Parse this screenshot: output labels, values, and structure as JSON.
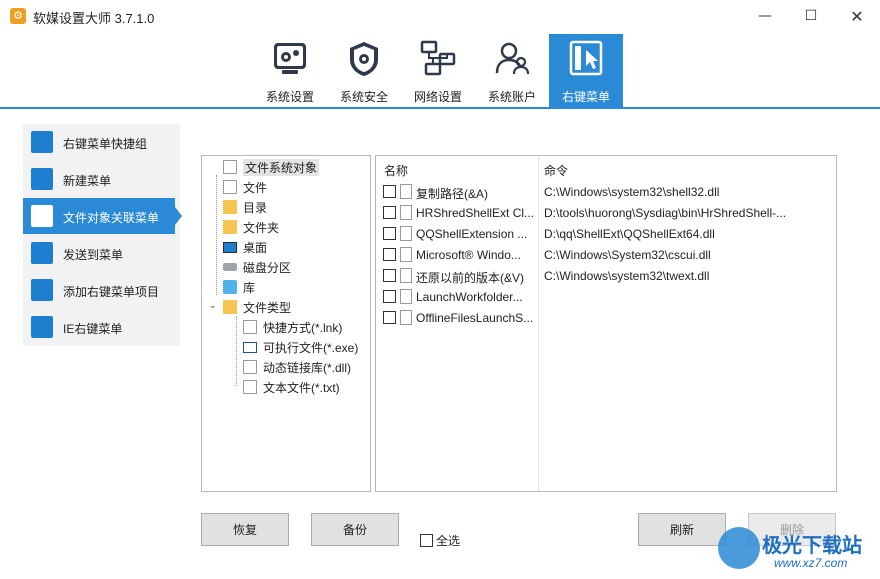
{
  "window": {
    "title": "软媒设置大师 3.7.1.0",
    "minimize_glyph": "—",
    "maximize_glyph": "☐",
    "close_glyph": "✕"
  },
  "toolbar": {
    "tabs": [
      {
        "label": "系统设置",
        "icon": "gear-icon"
      },
      {
        "label": "系统安全",
        "icon": "shield-gear-icon"
      },
      {
        "label": "网络设置",
        "icon": "network-icon"
      },
      {
        "label": "系统账户",
        "icon": "users-icon"
      },
      {
        "label": "右键菜单",
        "icon": "cursor-menu-icon"
      }
    ],
    "active_index": 4
  },
  "leftnav": {
    "items": [
      {
        "label": "右键菜单快捷组",
        "icon": "menu-group-icon"
      },
      {
        "label": "新建菜单",
        "icon": "new-menu-icon"
      },
      {
        "label": "文件对象关联菜单",
        "icon": "file-assoc-icon"
      },
      {
        "label": "发送到菜单",
        "icon": "send-to-icon"
      },
      {
        "label": "添加右键菜单项目",
        "icon": "add-item-icon"
      },
      {
        "label": "IE右键菜单",
        "icon": "ie-icon"
      }
    ],
    "active_index": 2
  },
  "tree": {
    "root": "文件系统对象",
    "items": [
      {
        "label": "文件",
        "icon": "document-icon"
      },
      {
        "label": "目录",
        "icon": "folder-icon"
      },
      {
        "label": "文件夹",
        "icon": "folder-icon"
      },
      {
        "label": "桌面",
        "icon": "desktop-icon"
      },
      {
        "label": "磁盘分区",
        "icon": "disk-icon"
      },
      {
        "label": "库",
        "icon": "library-icon"
      },
      {
        "label": "文件类型",
        "icon": "folder-icon",
        "expanded": true
      }
    ],
    "filetypes": [
      {
        "label": "快捷方式(*.lnk)",
        "icon": "shortcut-icon"
      },
      {
        "label": "可执行文件(*.exe)",
        "icon": "exe-icon"
      },
      {
        "label": "动态链接库(*.dll)",
        "icon": "dll-icon"
      },
      {
        "label": "文本文件(*.txt)",
        "icon": "text-file-icon"
      }
    ]
  },
  "list": {
    "col_name": "名称",
    "col_command": "命令",
    "rows": [
      {
        "name": "复制路径(&A)",
        "command": "C:\\Windows\\system32\\shell32.dll",
        "checked": false
      },
      {
        "name": "HRShredShellExt Cl...",
        "command": "D:\\tools\\huorong\\Sysdiag\\bin\\HrShredShell-...",
        "checked": false
      },
      {
        "name": "QQShellExtension ...",
        "command": "D:\\qq\\ShellExt\\QQShellExt64.dll",
        "checked": false
      },
      {
        "name": "Microsoft® Windo...",
        "command": "C:\\Windows\\System32\\cscui.dll",
        "checked": false
      },
      {
        "name": "还原以前的版本(&V)",
        "command": "C:\\Windows\\system32\\twext.dll",
        "checked": false
      },
      {
        "name": "LaunchWorkfolder...",
        "command": "",
        "checked": false
      },
      {
        "name": "OfflineFilesLaunchS...",
        "command": "",
        "checked": false
      }
    ]
  },
  "buttons": {
    "restore": "恢复",
    "backup": "备份",
    "select_all": "全选",
    "refresh": "刷新",
    "delete": "删除"
  },
  "watermark": {
    "text": "极光下载站",
    "sub": "www.xz7.com"
  }
}
